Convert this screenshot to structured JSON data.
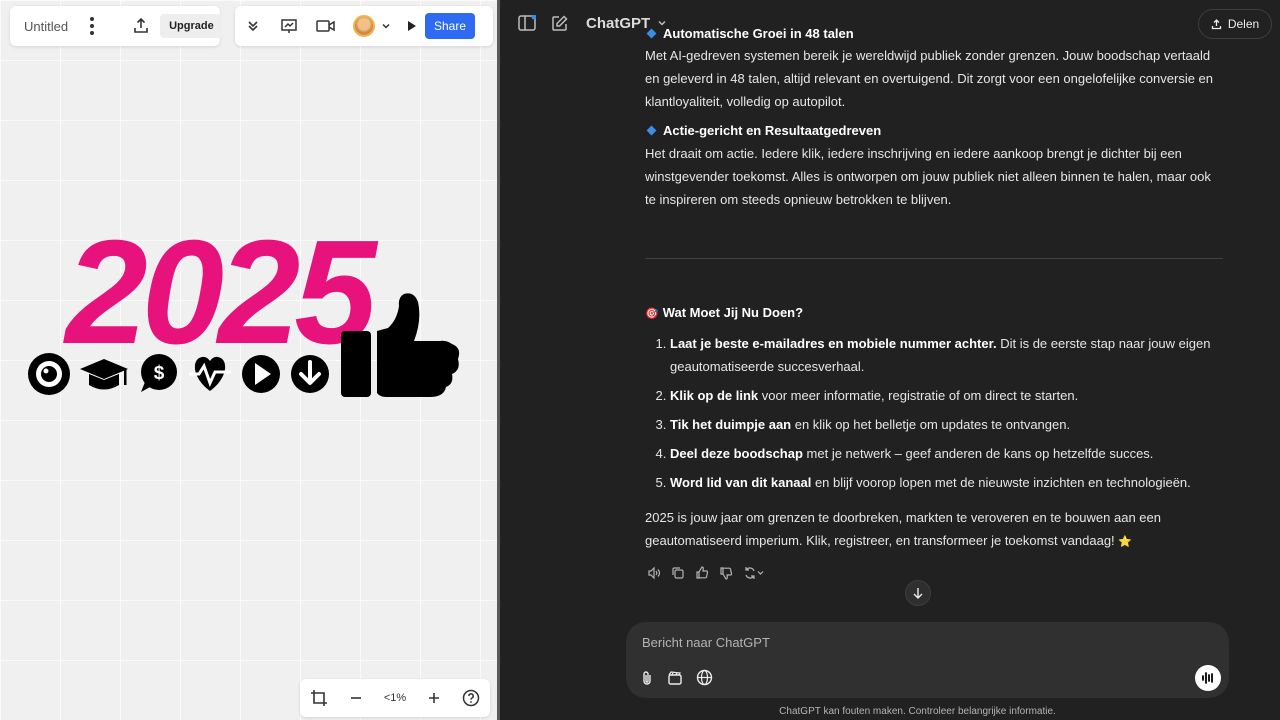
{
  "editor": {
    "doc_title": "Untitled",
    "upgrade_label": "Upgrade",
    "share_label": "Share",
    "zoom_level": "<1%"
  },
  "artwork": {
    "year_text": "2025",
    "year_color": "#e8127c",
    "icons": [
      "eye-icon",
      "graduation-cap-icon",
      "dollar-chat-icon",
      "heartbeat-icon",
      "play-icon",
      "download-icon",
      "thumbs-up-icon"
    ]
  },
  "chat": {
    "model_name": "ChatGPT",
    "share_label": "Delen",
    "partial_heading": "Automatische Groei in 48 talen",
    "para1": "Met AI-gedreven systemen bereik je wereldwijd publiek zonder grenzen. Jouw boodschap vertaald en geleverd in 48 talen, altijd relevant en overtuigend. Dit zorgt voor een ongelofelijke conversie en klantloyaliteit, volledig op autopilot.",
    "heading2": "Actie-gericht en Resultaatgedreven",
    "para2": "Het draait om actie. Iedere klik, iedere inschrijving en iedere aankoop brengt je dichter bij een winstgevender toekomst. Alles is ontworpen om jouw publiek niet alleen binnen te halen, maar ook te inspireren om steeds opnieuw betrokken te blijven.",
    "section_emoji": "🎯",
    "section_title": "Wat Moet Jij Nu Doen?",
    "steps": [
      {
        "bold": "Laat je beste e-mailadres en mobiele nummer achter.",
        "rest": " Dit is de eerste stap naar jouw eigen geautomatiseerde succesverhaal."
      },
      {
        "bold": "Klik op de link",
        "rest": " voor meer informatie, registratie of om direct te starten."
      },
      {
        "bold": "Tik het duimpje aan",
        "rest": " en klik op het belletje om updates te ontvangen."
      },
      {
        "bold": "Deel deze boodschap",
        "rest": " met je netwerk – geef anderen de kans op hetzelfde succes."
      },
      {
        "bold": "Word lid van dit kanaal",
        "rest": " en blijf voorop lopen met de nieuwste inzichten en technologieën."
      }
    ],
    "closing": "2025 is jouw jaar om grenzen te doorbreken, markten te veroveren en te bouwen aan een geautomatiseerd imperium. Klik, registreer, en transformeer je toekomst vandaag!",
    "closing_emoji": "⭐",
    "composer_placeholder": "Bericht naar ChatGPT",
    "disclaimer": "ChatGPT kan fouten maken. Controleer belangrijke informatie.",
    "accent": "#3a8ee6"
  }
}
